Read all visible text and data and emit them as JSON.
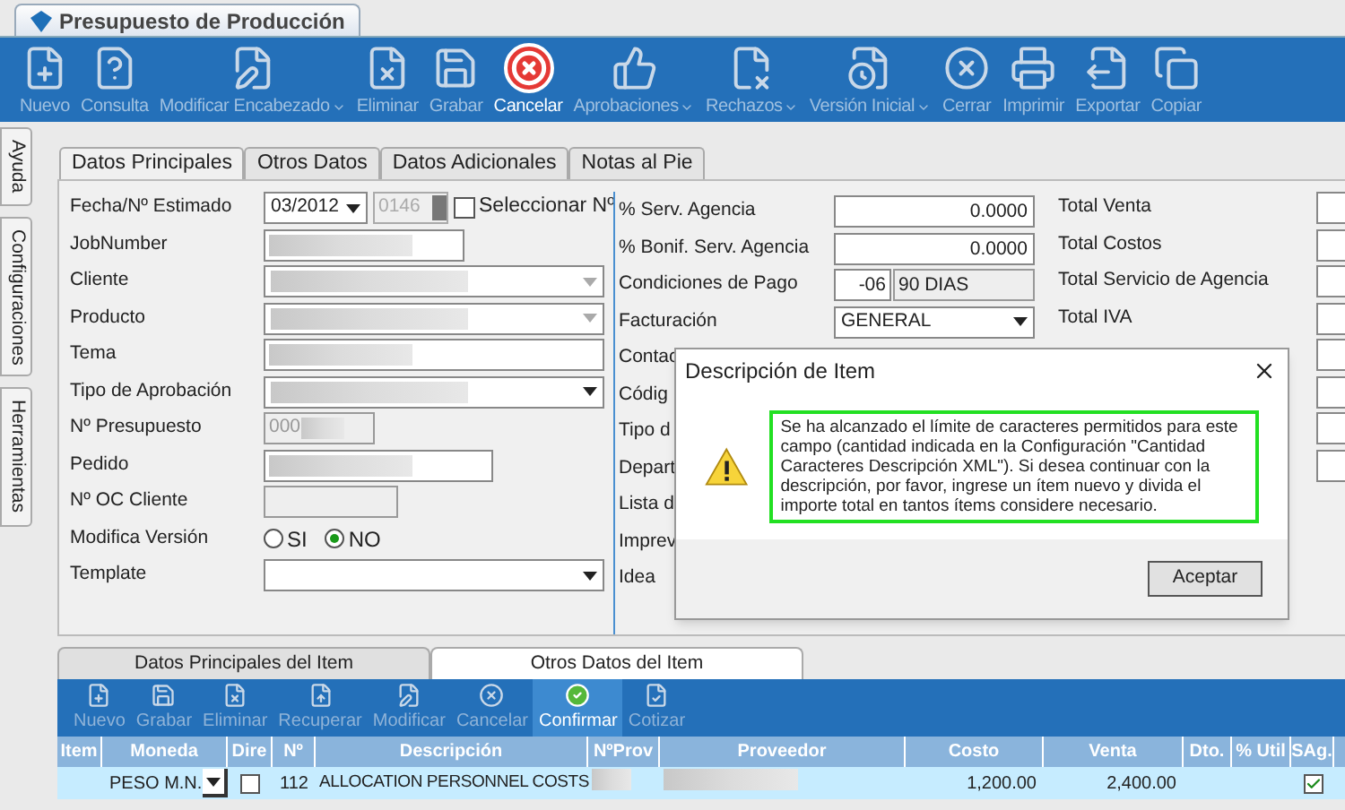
{
  "window": {
    "title": "Presupuesto de Producción"
  },
  "toolbar": [
    {
      "label": "Nuevo",
      "disabled": true,
      "dropdown": false
    },
    {
      "label": "Consulta",
      "disabled": true,
      "dropdown": false
    },
    {
      "label": "Modificar Encabezado",
      "disabled": true,
      "dropdown": true
    },
    {
      "label": "Eliminar",
      "disabled": true,
      "dropdown": false
    },
    {
      "label": "Grabar",
      "disabled": true,
      "dropdown": false
    },
    {
      "label": "Cancelar",
      "disabled": false,
      "dropdown": false
    },
    {
      "label": "Aprobaciones",
      "disabled": true,
      "dropdown": true
    },
    {
      "label": "Rechazos",
      "disabled": true,
      "dropdown": true
    },
    {
      "label": "Versión Inicial",
      "disabled": true,
      "dropdown": true
    },
    {
      "label": "Cerrar",
      "disabled": true,
      "dropdown": false
    },
    {
      "label": "Imprimir",
      "disabled": true,
      "dropdown": false
    },
    {
      "label": "Exportar",
      "disabled": true,
      "dropdown": false
    },
    {
      "label": "Copiar",
      "disabled": true,
      "dropdown": false
    }
  ],
  "side_tabs": [
    "Ayuda",
    "Configuraciones",
    "Herramientas"
  ],
  "tabs": [
    {
      "label": "Datos Principales",
      "selected": true
    },
    {
      "label": "Otros Datos",
      "selected": false
    },
    {
      "label": "Datos Adicionales",
      "selected": false
    },
    {
      "label": "Notas al Pie",
      "selected": false
    }
  ],
  "form_left": [
    {
      "label": "Fecha/Nº Estimado",
      "kind": "date",
      "value": "03/2012",
      "number": "0146",
      "checkbox": {
        "label": "Seleccionar Nº",
        "checked": false
      }
    },
    {
      "label": "JobNumber",
      "kind": "text",
      "redacted": true
    },
    {
      "label": "Cliente",
      "kind": "combo",
      "redacted": true,
      "disabled": true
    },
    {
      "label": "Producto",
      "kind": "combo",
      "redacted": true,
      "disabled": true
    },
    {
      "label": "Tema",
      "kind": "text",
      "redacted": true
    },
    {
      "label": "Tipo de Aprobación",
      "kind": "combo",
      "redacted": true,
      "disabled": false
    },
    {
      "label": "Nº Presupuesto",
      "kind": "readonly",
      "value": "000",
      "redacted": true
    },
    {
      "label": "Pedido",
      "kind": "text",
      "redacted": true
    },
    {
      "label": "Nº OC Cliente",
      "kind": "readonly"
    },
    {
      "label": "Modifica Versión",
      "kind": "radio",
      "options": [
        {
          "label": "SI",
          "selected": false
        },
        {
          "label": "NO",
          "selected": true
        }
      ]
    },
    {
      "label": "Template",
      "kind": "combo",
      "disabled": false
    }
  ],
  "form_middle": [
    {
      "label": "% Serv. Agencia",
      "kind": "number",
      "value": "0.0000"
    },
    {
      "label": "% Bonif. Serv. Agencia",
      "kind": "number",
      "value": "0.0000"
    },
    {
      "label": "Condiciones de Pago",
      "kind": "code",
      "code": "-06",
      "value": "90 DIAS"
    },
    {
      "label": "Facturación",
      "kind": "combo",
      "value": "GENERAL"
    },
    {
      "label": "Contac",
      "kind": "label"
    },
    {
      "label": "Códig",
      "kind": "label"
    },
    {
      "label": "Tipo d",
      "kind": "label"
    },
    {
      "label": "Depart",
      "kind": "label"
    },
    {
      "label": "Lista d",
      "kind": "label"
    },
    {
      "label": "Imprev",
      "kind": "label"
    },
    {
      "label": "Idea",
      "kind": "label"
    }
  ],
  "form_right": [
    {
      "label": "Total Venta",
      "kind": "labeled"
    },
    {
      "label": "Total Costos",
      "kind": "labeled"
    },
    {
      "label": "Total Servicio de Agencia",
      "kind": "labeled"
    },
    {
      "label": "Total IVA",
      "kind": "labeled"
    },
    {
      "kind": "field"
    },
    {
      "kind": "field"
    },
    {
      "kind": "field"
    },
    {
      "kind": "field"
    }
  ],
  "dialog": {
    "title": "Descripción de Item",
    "message": "Se ha alcanzado el límite de caracteres permitidos para este campo (cantidad indicada en la Configuración \"Cantidad Caracteres Descripción XML\"). Si desea continuar con la descripción, por favor, ingrese un ítem nuevo y divida el importe total en tantos ítems considere necesario.",
    "button": "Aceptar"
  },
  "item_tabs": [
    {
      "label": "Datos Principales del Item",
      "selected": false
    },
    {
      "label": "Otros Datos del Item",
      "selected": true
    }
  ],
  "item_toolbar": [
    {
      "label": "Nuevo",
      "disabled": true
    },
    {
      "label": "Grabar",
      "disabled": true
    },
    {
      "label": "Eliminar",
      "disabled": true
    },
    {
      "label": "Recuperar",
      "disabled": true
    },
    {
      "label": "Modificar",
      "disabled": true
    },
    {
      "label": "Cancelar",
      "disabled": true
    },
    {
      "label": "Confirmar",
      "disabled": false
    },
    {
      "label": "Cotizar",
      "disabled": true
    }
  ],
  "table": {
    "columns": [
      "Item",
      "Moneda",
      "Dire",
      "Nº",
      "Descripción",
      "NºProv",
      "Proveedor",
      "Costo",
      "Venta",
      "Dto.",
      "% Util",
      "SAg."
    ],
    "rows": [
      {
        "moneda": "PESO M.N.",
        "dire": false,
        "n": "112",
        "descripcion": "ALLOCATION PERSONNEL COSTS",
        "nprov_redacted": true,
        "proveedor_redacted": true,
        "costo": "1,200.00",
        "venta": "2,400.00",
        "sag": true
      }
    ]
  }
}
